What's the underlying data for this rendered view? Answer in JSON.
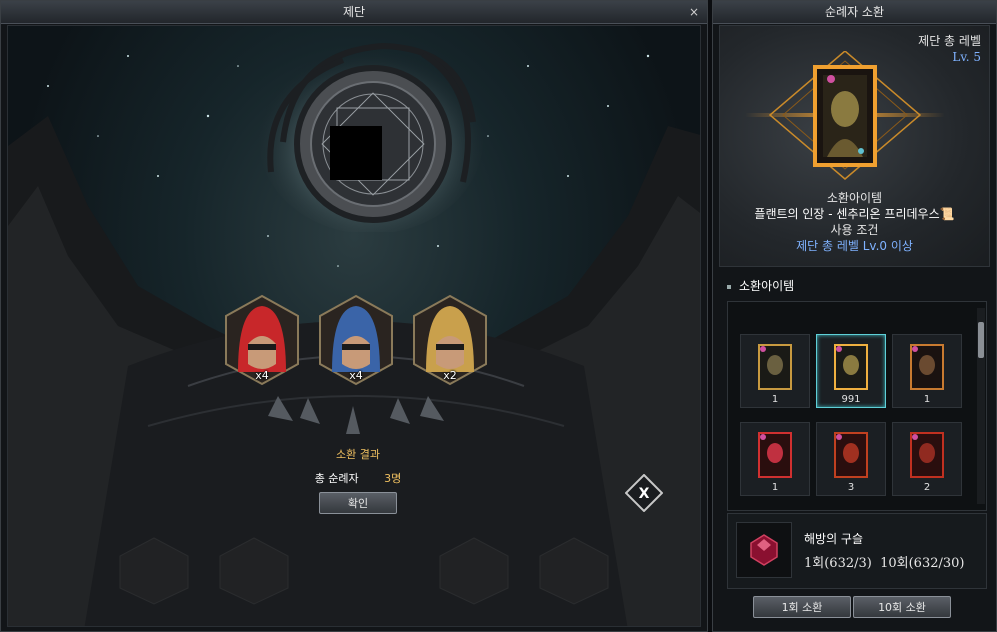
{
  "altar": {
    "title": "제단",
    "close": "×",
    "heroes": [
      {
        "color": "#c8272a",
        "count": "x4"
      },
      {
        "color": "#3a64a8",
        "count": "x4"
      },
      {
        "color": "#c9a04c",
        "count": "x2"
      }
    ],
    "result": {
      "title": "소환 결과",
      "total_label": "총 순례자",
      "total_value": "3명",
      "confirm": "확인"
    },
    "x_button": "X"
  },
  "summon": {
    "title": "순례자 소환",
    "altar_level_label": "제단 총 레벨",
    "altar_level_value": "Lv. 5",
    "info": {
      "item_label": "소환아이템",
      "item_name": "플랜트의 인장 - 센추리온 프리데우스",
      "condition_label": "사용 조건",
      "condition_value": "제단 총 레벨 Lv.0 이상"
    },
    "section_title": "소환아이템",
    "slots": [
      {
        "count": "1"
      },
      {
        "count": "991"
      },
      {
        "count": "1"
      },
      {
        "count": "1"
      },
      {
        "count": "3"
      },
      {
        "count": "2"
      }
    ],
    "orb": {
      "name": "해방의 구슬",
      "cost": "1회(632/3)  10회(632/30)"
    },
    "summon_1": "1회 소환",
    "summon_10": "10회 소환"
  }
}
